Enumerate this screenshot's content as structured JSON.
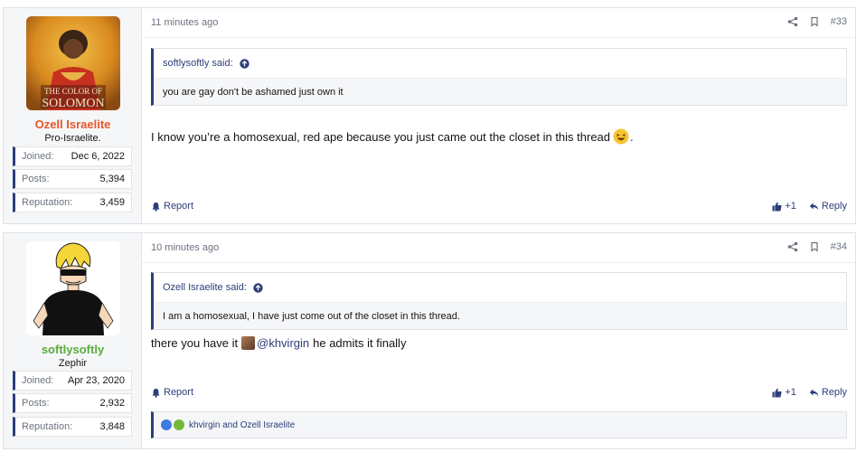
{
  "posts": [
    {
      "time": "11 minutes ago",
      "number": "#33",
      "user": {
        "name": "Ozell Israelite",
        "name_color": "#e8562a",
        "title": "Pro-Israelite.",
        "avatar_text_line1": "THE COLOR OF",
        "avatar_text_line2": "SOLOMON",
        "stats": [
          {
            "label": "Joined:",
            "value": "Dec 6, 2022"
          },
          {
            "label": "Posts:",
            "value": "5,394"
          },
          {
            "label": "Reputation:",
            "value": "3,459"
          }
        ]
      },
      "quote": {
        "author": "softlysoftly said:",
        "text": "you are gay don't be ashamed just own it"
      },
      "message": {
        "text": "I know you’re a homosexual, red ape because you just came out the closet in this thread",
        "suffix": "."
      },
      "footer": {
        "report": "Report",
        "like_count": "+1",
        "reply": "Reply"
      }
    },
    {
      "time": "10 minutes ago",
      "number": "#34",
      "user": {
        "name": "softlysoftly",
        "name_color": "#5aab3c",
        "title": "Zephir",
        "stats": [
          {
            "label": "Joined:",
            "value": "Apr 23, 2020"
          },
          {
            "label": "Posts:",
            "value": "2,932"
          },
          {
            "label": "Reputation:",
            "value": "3,848"
          }
        ]
      },
      "quote": {
        "author": "Ozell Israelite said:",
        "text": "I am a homosexual, I have just come out of the closet in this thread."
      },
      "message": {
        "prefix": "there you have it",
        "mention": "@khvirgin",
        "suffix": "he admits it finally"
      },
      "footer": {
        "report": "Report",
        "like_count": "+1",
        "reply": "Reply"
      },
      "reactions": {
        "text": "khvirgin and Ozell Israelite"
      }
    }
  ],
  "colors": {
    "accent": "#2c3e7a",
    "meta": "#6c7280"
  }
}
